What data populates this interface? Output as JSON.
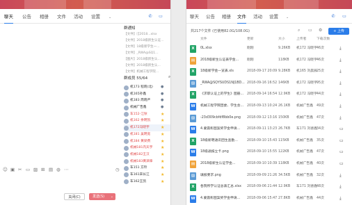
{
  "colors": {
    "accent": "#2b7de9",
    "header": "#c9475a",
    "star": "#f2b829",
    "send": "#e9727a",
    "red_text": "#e04848"
  },
  "left": {
    "tabs": [
      "聊天",
      "公告",
      "相册",
      "文件",
      "活动",
      "设置"
    ],
    "header_icons": [
      "phone-icon",
      "chat-icon"
    ],
    "notice_title": "群通知",
    "notices": [
      "【文件】[【2018...xlsx",
      "【文件】2018级新生认证...",
      "【文件】18级新学生一...",
      "【文件】_RWA@SQ1...",
      "【图片】2018级新生认...",
      "【文件】2018级新生认...",
      "【文件】机械工程学院..."
    ],
    "members_title": "群成员 55/64",
    "members": [
      {
        "name": "机173 程晓(北)",
        "icon": "person",
        "red": false
      },
      {
        "name": "机165孙鑫",
        "icon": "person",
        "red": false
      },
      {
        "name": "机183 周晓严",
        "icon": "person",
        "red": false
      },
      {
        "name": "机械广告鑫",
        "icon": "person",
        "red": false
      },
      {
        "name": "车152-江秋",
        "icon": "star",
        "red": true
      },
      {
        "name": "机162 余明凯",
        "icon": "star",
        "red": true
      },
      {
        "name": "机172冯晓宇",
        "icon": "star",
        "red": true,
        "highlight": true
      },
      {
        "name": "机181 吴明宽",
        "icon": "star",
        "red": true
      },
      {
        "name": "机184 黄梁费",
        "icon": "star",
        "red": true
      },
      {
        "name": "机械181内天宇",
        "icon": "star",
        "red": true
      },
      {
        "name": "机械182王汉",
        "icon": "star",
        "red": true
      },
      {
        "name": "机械183黄泽锋",
        "icon": "star",
        "red": true
      },
      {
        "name": "车151 方玲",
        "icon": "star",
        "red": false
      },
      {
        "name": "车161宋长江",
        "icon": "star",
        "red": false
      },
      {
        "name": "车162王凯",
        "icon": "star",
        "red": false
      }
    ],
    "toolbar_icons": [
      "emoji-icon",
      "gif-icon",
      "cut-icon",
      "folder-icon",
      "image-icon",
      "gift-icon",
      "screen-icon",
      "mic-icon",
      "more-icon"
    ],
    "history_icon": "clock-icon",
    "close_label": "关闭(C)",
    "send_label": "发送(S)"
  },
  "right": {
    "tabs": [
      "聊天",
      "公告",
      "相册",
      "文件",
      "活动",
      "设置"
    ],
    "summary": "共217个文件 (已使用82.0G/108.0G)",
    "upload_label": "+ 上传",
    "columns": [
      "文件",
      "更新",
      "大小",
      "上传者",
      "下载次数"
    ],
    "files": [
      {
        "name": "0L.xlsx",
        "time": "刚刚",
        "size": "9.26KB",
        "uploader": "机172 冯晓宇",
        "downloads": "46次",
        "type": "x",
        "action": "download"
      },
      {
        "name": "2018级新生认证表学金...",
        "time": "刚刚",
        "size": "118KB",
        "uploader": "机172 冯晓宇",
        "downloads": "46次",
        "type": "doc",
        "action": "download"
      },
      {
        "name": "18级新学金一览表.xls",
        "time": "2018-09-17 20:09",
        "size": "9.28KB",
        "uploader": "机165 刘晨辰",
        "downloads": "25次",
        "type": "x",
        "action": "download"
      },
      {
        "name": "_RWA@SQYSUDS1NJ1BD...",
        "time": "2018-09-16 16:52",
        "size": "146KB",
        "uploader": "机172 冯晓宇",
        "downloads": "95次",
        "type": "img",
        "action": "download"
      },
      {
        "name": "《求职认证上的学生》图册...",
        "time": "2018-09-14 16:54",
        "size": "12.9KB",
        "uploader": "机172 冯晓宇",
        "downloads": "44次",
        "type": "x",
        "action": "download"
      },
      {
        "name": "机械工程学院团委、学生会...",
        "time": "2018-09-13 10:24",
        "size": "26.1KB",
        "uploader": "机械广告鑫",
        "downloads": "49次",
        "type": "w",
        "action": "download"
      },
      {
        "name": "-23d309cbfdf8bb0e.png",
        "time": "2018-09-12 13:16",
        "size": "150KB",
        "uploader": "机械广告鑫",
        "downloads": "47次",
        "type": "img",
        "action": "download"
      },
      {
        "name": "4.蒙震彰图案奖学金申请...",
        "time": "2018-09-11 13:23",
        "size": "26.7KB",
        "uploader": "车171 刘德鑫",
        "downloads": "34次",
        "type": "w",
        "action": "folder"
      },
      {
        "name": "18级新聘通讯团生查勤...",
        "time": "2018-09-10 15:43",
        "size": "115KB",
        "uploader": "机械广告鑫",
        "downloads": "35次",
        "type": "x",
        "action": "folder"
      },
      {
        "name": "18级通报立卡.png",
        "time": "2018-09-10 15:55",
        "size": "122KB",
        "uploader": "机械广告鑫",
        "downloads": "47次",
        "type": "w",
        "action": "folder"
      },
      {
        "name": "2018级新生认证学金...",
        "time": "2018-09-10 10:39",
        "size": "118KB",
        "uploader": "机械广告鑫",
        "downloads": "40次",
        "type": "doc",
        "action": "folder"
      },
      {
        "name": "填报要求.png",
        "time": "2018-09-09 21:26",
        "size": "34.5KB",
        "uploader": "机械广告鑫",
        "downloads": "32次",
        "type": "img",
        "action": "download"
      },
      {
        "name": "各院所学认证总表汇总.xlsx",
        "time": "2018-09-06 21:44",
        "size": "12.9KB",
        "uploader": "车171 刘德鑫",
        "downloads": "48次",
        "type": "x",
        "action": "download"
      },
      {
        "name": "4.蒙震彰图案奖学金申请...",
        "time": "2018-09-06 15:47",
        "size": "27.8KB",
        "uploader": "机械广告鑫",
        "downloads": "44次",
        "type": "w",
        "action": "download"
      }
    ]
  }
}
